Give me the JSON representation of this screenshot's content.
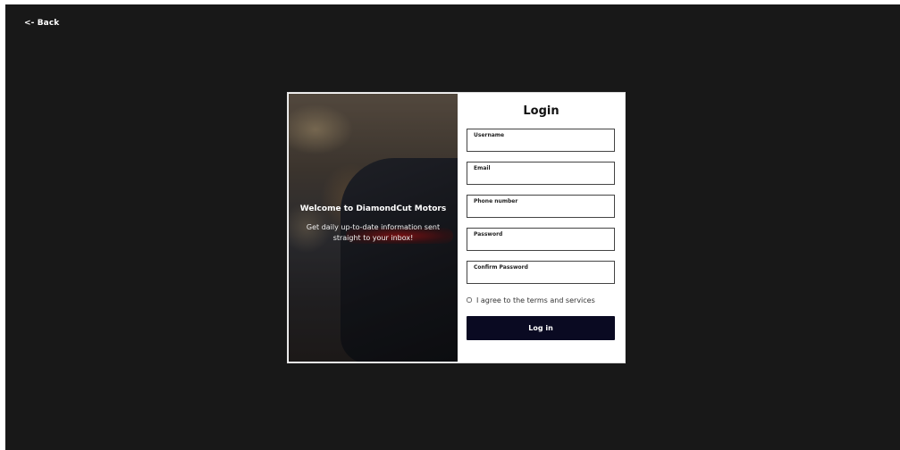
{
  "nav": {
    "back_label": "<- Back"
  },
  "hero": {
    "title": "Welcome to DiamondCut Motors",
    "subtitle": "Get daily up-to-date information sent straight to your inbox!"
  },
  "form": {
    "title": "Login",
    "fields": [
      {
        "label": "Username",
        "value": ""
      },
      {
        "label": "Email",
        "value": ""
      },
      {
        "label": "Phone number",
        "value": ""
      },
      {
        "label": "Password",
        "value": ""
      },
      {
        "label": "Confirm Password",
        "value": ""
      }
    ],
    "terms_label": "I agree to the terms and services",
    "terms_checked": false,
    "submit_label": "Log in"
  },
  "colors": {
    "page_background": "#181818",
    "card_background": "#ffffff",
    "button_background": "#0a0a22",
    "button_text": "#ffffff"
  }
}
